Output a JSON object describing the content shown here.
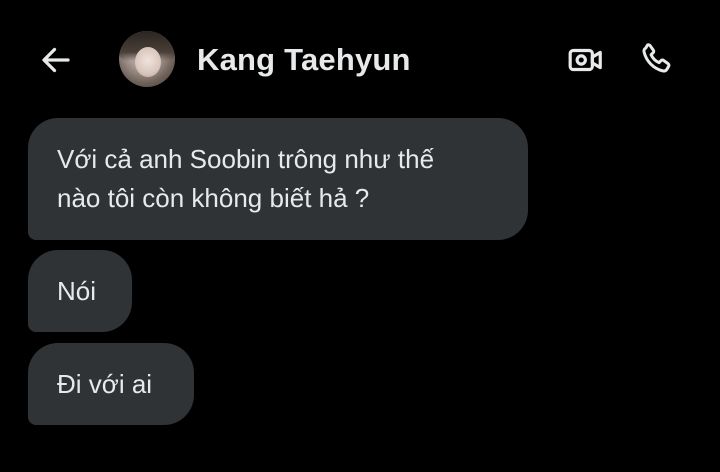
{
  "header": {
    "contact_name": "Kang Taehyun",
    "back_icon": "arrow-left-icon",
    "video_icon": "video-call-icon",
    "call_icon": "phone-icon"
  },
  "messages": [
    {
      "text": "Với cả anh Soobin trông như thế\nnào tôi còn không biết hả ?"
    },
    {
      "text": "Nói"
    },
    {
      "text": "Đi với ai"
    }
  ],
  "colors": {
    "background": "#000000",
    "bubble": "#2f3336",
    "text": "#e7e9ea"
  }
}
